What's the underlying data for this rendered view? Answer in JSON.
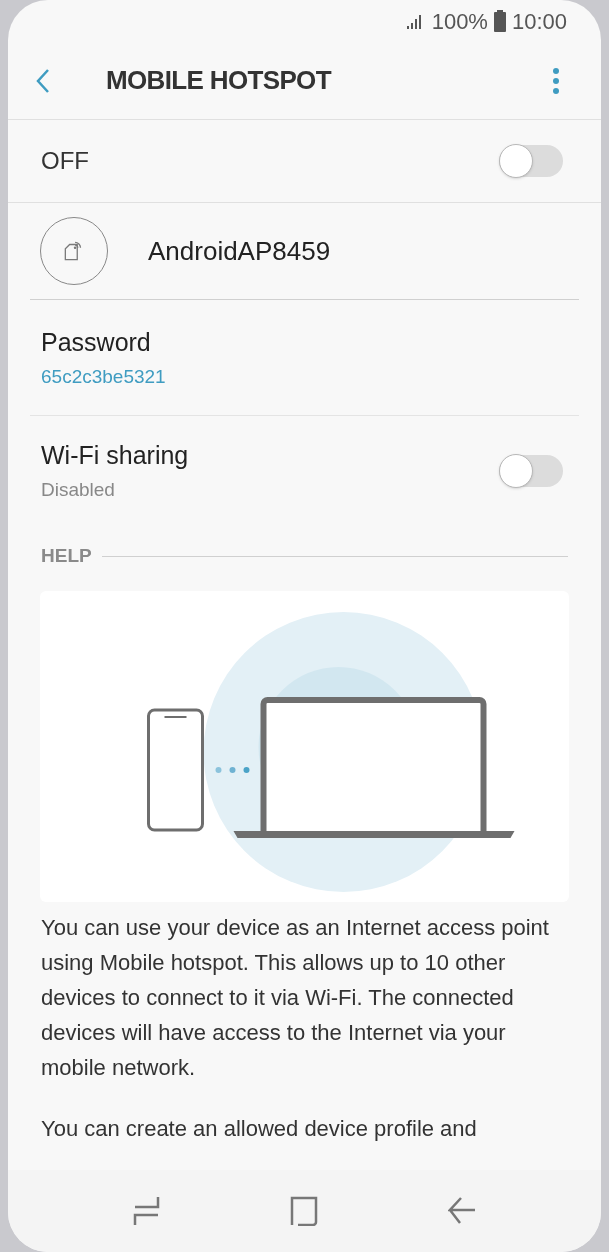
{
  "status_bar": {
    "battery": "100%",
    "time": "10:00"
  },
  "header": {
    "title": "MOBILE HOTSPOT"
  },
  "master_switch": {
    "label": "OFF",
    "on": false
  },
  "network": {
    "name": "AndroidAP8459"
  },
  "password": {
    "label": "Password",
    "value": "65c2c3be5321"
  },
  "wifi_sharing": {
    "label": "Wi-Fi sharing",
    "status": "Disabled",
    "on": false
  },
  "help": {
    "heading": "HELP",
    "paragraphs": [
      "You can use your device as an Internet access point using Mobile hotspot. This allows up to 10 other devices to connect to it via Wi-Fi. The connected devices will have access to the Internet via your mobile network.",
      "You can create an allowed device profile and"
    ]
  }
}
